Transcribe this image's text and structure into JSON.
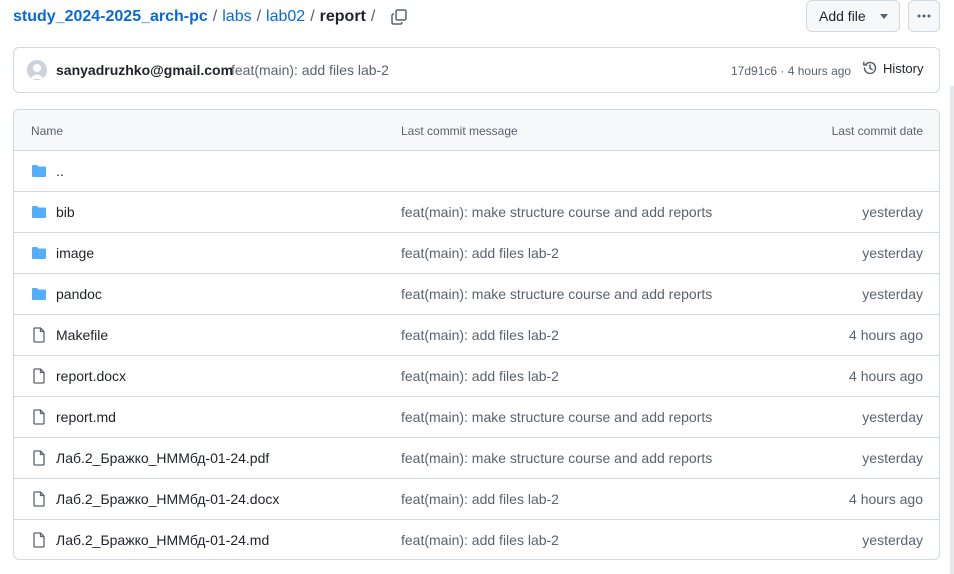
{
  "breadcrumb": {
    "repo": "study_2024-2025_arch-pc",
    "parts": [
      "labs",
      "lab02"
    ],
    "current": "report",
    "separator": "/"
  },
  "toolbar": {
    "add_file_label": "Add file",
    "more_label": "···"
  },
  "commit": {
    "author": "sanyadruzhko@gmail.com",
    "message": "feat(main): add files lab-2",
    "sha": "17d91c6",
    "separator": " · ",
    "time": "4 hours ago",
    "history_label": "History"
  },
  "table": {
    "headers": {
      "name": "Name",
      "message": "Last commit message",
      "date": "Last commit date"
    },
    "rows": [
      {
        "name": "..",
        "type": "folder",
        "message": "",
        "date": ""
      },
      {
        "name": "bib",
        "type": "folder",
        "message": "feat(main): make structure course and add reports",
        "date": "yesterday"
      },
      {
        "name": "image",
        "type": "folder",
        "message": "feat(main): add files lab-2",
        "date": "yesterday"
      },
      {
        "name": "pandoc",
        "type": "folder",
        "message": "feat(main): make structure course and add reports",
        "date": "yesterday"
      },
      {
        "name": "Makefile",
        "type": "file",
        "message": "feat(main): add files lab-2",
        "date": "4 hours ago"
      },
      {
        "name": "report.docx",
        "type": "file",
        "message": "feat(main): add files lab-2",
        "date": "4 hours ago"
      },
      {
        "name": "report.md",
        "type": "file",
        "message": "feat(main): make structure course and add reports",
        "date": "yesterday"
      },
      {
        "name": "Лаб.2_Бражко_НММбд-01-24.pdf",
        "type": "file",
        "message": "feat(main): make structure course and add reports",
        "date": "yesterday"
      },
      {
        "name": "Лаб.2_Бражко_НММбд-01-24.docx",
        "type": "file",
        "message": "feat(main): add files lab-2",
        "date": "4 hours ago"
      },
      {
        "name": "Лаб.2_Бражко_НММбд-01-24.md",
        "type": "file",
        "message": "feat(main): add files lab-2",
        "date": "yesterday"
      }
    ]
  },
  "colors": {
    "link": "#0969da",
    "folder": "#54aeff",
    "muted": "#59636e",
    "border": "#d1d9e0"
  }
}
